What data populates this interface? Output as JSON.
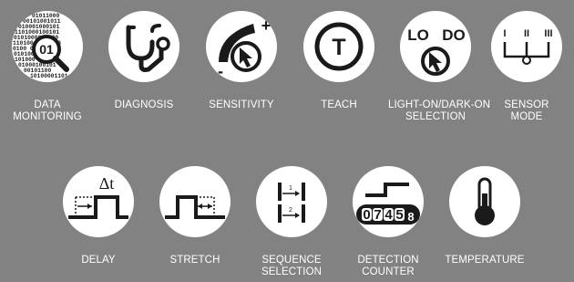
{
  "colors": {
    "background": "#828282",
    "circle": "#ffffff",
    "icon": "#1a1a1a",
    "label": "#ffffff"
  },
  "row1": [
    {
      "icon": "magnifier-binary-icon",
      "badge": "01",
      "label": [
        "DATA",
        "MONITORING"
      ],
      "binary": [
        "01011000",
        "00101001011",
        "010001000101",
        "1101000100101",
        "0101000001000",
        "110100 0110100",
        "0100 00100",
        "010100 01000",
        "101000 0100",
        "01000100101",
        "00101100",
        "10100001101"
      ]
    },
    {
      "icon": "stethoscope-icon",
      "label": [
        "DIAGNOSIS"
      ]
    },
    {
      "icon": "sensitivity-knob-icon",
      "plus": "+",
      "minus": "-",
      "label": [
        "SENSITIVITY"
      ]
    },
    {
      "icon": "teach-icon",
      "letter": "T",
      "label": [
        "TEACH"
      ]
    },
    {
      "icon": "light-dark-selector-icon",
      "left": "LO",
      "right": "DO",
      "label": [
        "LIGHT-ON/DARK-ON",
        "SELECTION"
      ]
    },
    {
      "icon": "sensor-mode-switch-icon",
      "ticks": [
        "I",
        "II",
        "III"
      ],
      "label": [
        "SENSOR",
        "MODE"
      ]
    }
  ],
  "row2": [
    {
      "icon": "delay-timing-icon",
      "symbol": "Δt",
      "label": [
        "DELAY"
      ]
    },
    {
      "icon": "stretch-timing-icon",
      "label": [
        "STRETCH"
      ]
    },
    {
      "icon": "sequence-icon",
      "steps": [
        "1",
        "2"
      ],
      "label": [
        "SEQUENCE",
        "SELECTION"
      ]
    },
    {
      "icon": "detection-counter-icon",
      "digits": [
        "0",
        "7",
        "4",
        "5",
        "8"
      ],
      "label": [
        "DETECTION",
        "COUNTER"
      ]
    },
    {
      "icon": "thermometer-icon",
      "label": [
        "TEMPERATURE"
      ]
    }
  ]
}
